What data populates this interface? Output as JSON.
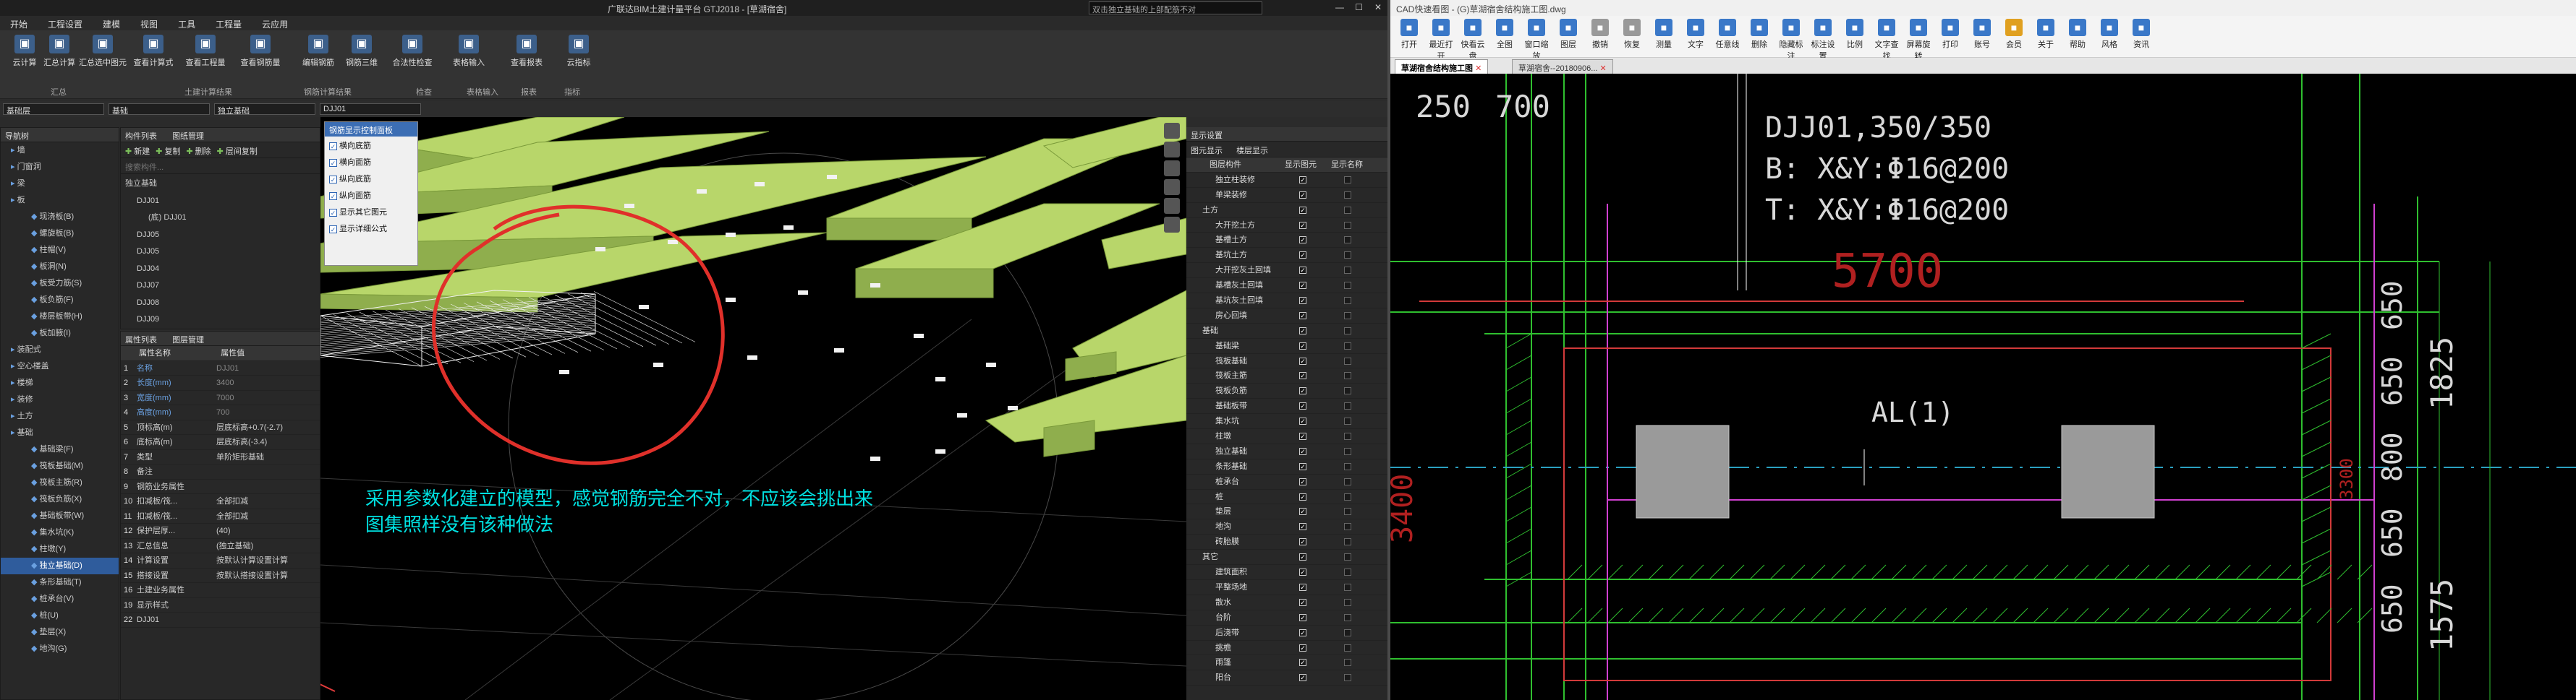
{
  "left_app": {
    "title": "广联达BIM土建计量平台 GTJ2018 - [草湖宿舍]",
    "search_placeholder": "双击独立基础的上部配筋不对",
    "menu": [
      "开始",
      "工程设置",
      "建模",
      "视图",
      "工具",
      "工程量",
      "云应用"
    ],
    "ribbon": [
      {
        "label": "云计算",
        "icon": "cloud-icon"
      },
      {
        "label": "汇总计算",
        "icon": "sigma-icon"
      },
      {
        "label": "汇总选中图元",
        "icon": "sum-selected-icon"
      },
      {
        "label": "查看计算式",
        "icon": "formula-icon"
      },
      {
        "label": "查看工程量",
        "icon": "quantity-icon"
      },
      {
        "label": "查看钢筋量",
        "icon": "rebar-icon"
      },
      {
        "label": "编辑钢筋",
        "icon": "edit-rebar-icon"
      },
      {
        "label": "钢筋三维",
        "icon": "rebar-3d-icon"
      },
      {
        "label": "合法性检查",
        "icon": "check-icon"
      },
      {
        "label": "表格输入",
        "icon": "table-icon"
      },
      {
        "label": "查看报表",
        "icon": "report-icon"
      },
      {
        "label": "云指标",
        "icon": "cloud-index-icon"
      }
    ],
    "ribbon_groups": [
      "汇总",
      "土建计算结果",
      "钢筋计算结果",
      "检查",
      "表格输入",
      "报表",
      "指标"
    ],
    "selectors": [
      "基础层",
      "基础",
      "独立基础",
      "DJJ01"
    ],
    "nav": {
      "title": "导航树",
      "items": [
        {
          "label": "墙",
          "sub": false
        },
        {
          "label": "门窗洞",
          "sub": false
        },
        {
          "label": "梁",
          "sub": false
        },
        {
          "label": "板",
          "sub": false
        },
        {
          "label": "现浇板(B)",
          "sub": true
        },
        {
          "label": "螺旋板(B)",
          "sub": true
        },
        {
          "label": "柱帽(V)",
          "sub": true
        },
        {
          "label": "板洞(N)",
          "sub": true
        },
        {
          "label": "板受力筋(S)",
          "sub": true
        },
        {
          "label": "板负筋(F)",
          "sub": true
        },
        {
          "label": "楼层板带(H)",
          "sub": true
        },
        {
          "label": "板加腋(I)",
          "sub": true
        },
        {
          "label": "装配式",
          "sub": false
        },
        {
          "label": "空心楼盖",
          "sub": false
        },
        {
          "label": "楼梯",
          "sub": false
        },
        {
          "label": "装修",
          "sub": false
        },
        {
          "label": "土方",
          "sub": false
        },
        {
          "label": "基础",
          "sub": false
        },
        {
          "label": "基础梁(F)",
          "sub": true
        },
        {
          "label": "筏板基础(M)",
          "sub": true
        },
        {
          "label": "筏板主筋(R)",
          "sub": true
        },
        {
          "label": "筏板负筋(X)",
          "sub": true
        },
        {
          "label": "基础板带(W)",
          "sub": true
        },
        {
          "label": "集水坑(K)",
          "sub": true
        },
        {
          "label": "柱墩(Y)",
          "sub": true
        },
        {
          "label": "独立基础(D)",
          "sub": true,
          "active": true
        },
        {
          "label": "条形基础(T)",
          "sub": true
        },
        {
          "label": "桩承台(V)",
          "sub": true
        },
        {
          "label": "桩(U)",
          "sub": true
        },
        {
          "label": "垫层(X)",
          "sub": true
        },
        {
          "label": "地沟(G)",
          "sub": true
        }
      ]
    },
    "component_list": {
      "tabs": [
        "构件列表",
        "图纸管理"
      ],
      "actions": [
        "新建",
        "复制",
        "删除",
        "层间复制"
      ],
      "search_placeholder": "搜索构件...",
      "tree": [
        {
          "label": "独立基础",
          "level": 0
        },
        {
          "label": "DJJ01",
          "level": 1
        },
        {
          "label": "(底) DJJ01",
          "level": 2
        },
        {
          "label": "DJJ05",
          "level": 1
        },
        {
          "label": "DJJ05",
          "level": 1
        },
        {
          "label": "DJJ04",
          "level": 1
        },
        {
          "label": "DJJ07",
          "level": 1
        },
        {
          "label": "DJJ08",
          "level": 1
        },
        {
          "label": "DJJ09",
          "level": 1
        }
      ]
    },
    "properties": {
      "tabs": [
        "属性列表",
        "图层管理"
      ],
      "headers": [
        "属性名称",
        "属性值"
      ],
      "rows": [
        {
          "n": "1",
          "name": "名称",
          "value": "DJJ01"
        },
        {
          "n": "2",
          "name": "长度(mm)",
          "value": "3400"
        },
        {
          "n": "3",
          "name": "宽度(mm)",
          "value": "7000"
        },
        {
          "n": "4",
          "name": "高度(mm)",
          "value": "700"
        },
        {
          "n": "5",
          "name": "顶标高(m)",
          "value": "层底标高+0.7(-2.7)"
        },
        {
          "n": "6",
          "name": "底标高(m)",
          "value": "层底标高(-3.4)"
        },
        {
          "n": "7",
          "name": "类型",
          "value": "单阶矩形基础"
        },
        {
          "n": "8",
          "name": "备注",
          "value": ""
        },
        {
          "n": "9",
          "name": "钢筋业务属性",
          "value": ""
        },
        {
          "n": "10",
          "name": "扣减板/筏...",
          "value": "全部扣减"
        },
        {
          "n": "11",
          "name": "扣减板/筏...",
          "value": "全部扣减"
        },
        {
          "n": "12",
          "name": "保护层厚...",
          "value": "(40)"
        },
        {
          "n": "13",
          "name": "汇总信息",
          "value": "(独立基础)"
        },
        {
          "n": "14",
          "name": "计算设置",
          "value": "按默认计算设置计算"
        },
        {
          "n": "15",
          "name": "搭接设置",
          "value": "按默认搭接设置计算"
        },
        {
          "n": "16",
          "name": "土建业务属性",
          "value": ""
        },
        {
          "n": "19",
          "name": "显示样式",
          "value": ""
        },
        {
          "n": "22",
          "name": "DJJ01",
          "value": ""
        }
      ]
    },
    "rebar_display_panel": {
      "title": "钢筋显示控制面板",
      "items": [
        "横向底筋",
        "横向面筋",
        "纵向底筋",
        "纵向面筋",
        "显示其它图元",
        "显示详细公式"
      ]
    },
    "annotation": {
      "line1": "采用参数化建立的模型，感觉钢筋完全不对，不应该会挑出来",
      "line2": "图集照样没有该种做法"
    },
    "display_settings": {
      "title": "显示设置",
      "tabs": [
        "图元显示",
        "楼层显示"
      ],
      "headers": [
        "图层构件",
        "显示图元",
        "显示名称"
      ],
      "rows": [
        {
          "label": "独立柱装修",
          "on": true,
          "name": false
        },
        {
          "label": "单梁装修",
          "on": true,
          "name": false
        },
        {
          "label": "土方",
          "on": true,
          "name": false,
          "group": true
        },
        {
          "label": "大开挖土方",
          "on": true,
          "name": false
        },
        {
          "label": "基槽土方",
          "on": true,
          "name": false
        },
        {
          "label": "基坑土方",
          "on": true,
          "name": false
        },
        {
          "label": "大开挖灰土回填",
          "on": true,
          "name": false
        },
        {
          "label": "基槽灰土回填",
          "on": true,
          "name": false
        },
        {
          "label": "基坑灰土回填",
          "on": true,
          "name": false
        },
        {
          "label": "房心回填",
          "on": true,
          "name": false
        },
        {
          "label": "基础",
          "on": true,
          "name": false,
          "group": true
        },
        {
          "label": "基础梁",
          "on": true,
          "name": false
        },
        {
          "label": "筏板基础",
          "on": true,
          "name": false
        },
        {
          "label": "筏板主筋",
          "on": true,
          "name": false
        },
        {
          "label": "筏板负筋",
          "on": true,
          "name": false
        },
        {
          "label": "基础板带",
          "on": true,
          "name": false
        },
        {
          "label": "集水坑",
          "on": true,
          "name": false
        },
        {
          "label": "柱墩",
          "on": true,
          "name": false
        },
        {
          "label": "独立基础",
          "on": true,
          "name": false
        },
        {
          "label": "条形基础",
          "on": true,
          "name": false
        },
        {
          "label": "桩承台",
          "on": true,
          "name": false
        },
        {
          "label": "桩",
          "on": true,
          "name": false
        },
        {
          "label": "垫层",
          "on": true,
          "name": false
        },
        {
          "label": "地沟",
          "on": true,
          "name": false
        },
        {
          "label": "砖胎膜",
          "on": true,
          "name": false
        },
        {
          "label": "其它",
          "on": true,
          "name": false,
          "group": true
        },
        {
          "label": "建筑面积",
          "on": true,
          "name": false
        },
        {
          "label": "平整场地",
          "on": true,
          "name": false
        },
        {
          "label": "散水",
          "on": true,
          "name": false
        },
        {
          "label": "台阶",
          "on": true,
          "name": false
        },
        {
          "label": "后浇带",
          "on": true,
          "name": false
        },
        {
          "label": "挑檐",
          "on": true,
          "name": false
        },
        {
          "label": "雨篷",
          "on": true,
          "name": false
        },
        {
          "label": "阳台",
          "on": true,
          "name": false
        }
      ]
    },
    "colors": {
      "accent": "#2f5c9c",
      "slab": "#b8d66a",
      "rebar": "#f2f2f2",
      "annotation": "#00e0e0",
      "circle": "#e0302a"
    }
  },
  "right_app": {
    "title": "CAD快速看图 - (G)草湖宿舍结构施工图.dwg",
    "tools": [
      {
        "label": "打开",
        "color": "#3a78c8"
      },
      {
        "label": "最近打开",
        "color": "#3a78c8"
      },
      {
        "label": "快看云盘",
        "color": "#3a78c8"
      },
      {
        "label": "全图",
        "color": "#3a78c8"
      },
      {
        "label": "窗口缩放",
        "color": "#3a78c8"
      },
      {
        "label": "图层",
        "color": "#3a78c8"
      },
      {
        "label": "撤销",
        "color": "#999999"
      },
      {
        "label": "恢复",
        "color": "#999999"
      },
      {
        "label": "测量",
        "color": "#3a78c8"
      },
      {
        "label": "文字",
        "color": "#3a78c8"
      },
      {
        "label": "任意线",
        "color": "#3a78c8"
      },
      {
        "label": "删除",
        "color": "#3a78c8"
      },
      {
        "label": "隐藏标注",
        "color": "#3a78c8"
      },
      {
        "label": "标注设置",
        "color": "#3a78c8"
      },
      {
        "label": "比例",
        "color": "#3a78c8"
      },
      {
        "label": "文字查找",
        "color": "#3a78c8"
      },
      {
        "label": "屏幕旋转",
        "color": "#3a78c8"
      },
      {
        "label": "打印",
        "color": "#3a78c8"
      },
      {
        "label": "账号",
        "color": "#3a78c8"
      },
      {
        "label": "会员",
        "color": "#e0a020"
      },
      {
        "label": "关于",
        "color": "#3a78c8"
      },
      {
        "label": "帮助",
        "color": "#3a78c8"
      },
      {
        "label": "风格",
        "color": "#3a78c8"
      },
      {
        "label": "资讯",
        "color": "#3a78c8"
      }
    ],
    "tabs": [
      "草湖宿舍结构施工图",
      "草湖宿舍--20180906..."
    ],
    "cad": {
      "label_main": "DJJ01,350/350",
      "label_b": "B: X&Y:Φ16@200",
      "label_t": "T: X&Y:Φ16@200",
      "dim_5700": "5700",
      "dim_250": "250",
      "dim_700": "700",
      "al": "AL(1)",
      "dims_right": [
        "650",
        "650",
        "800",
        "650",
        "650"
      ],
      "dim_1825": "1825",
      "dim_1575": "1575",
      "dim_3400": "3400",
      "dim_3300": "3300"
    }
  }
}
